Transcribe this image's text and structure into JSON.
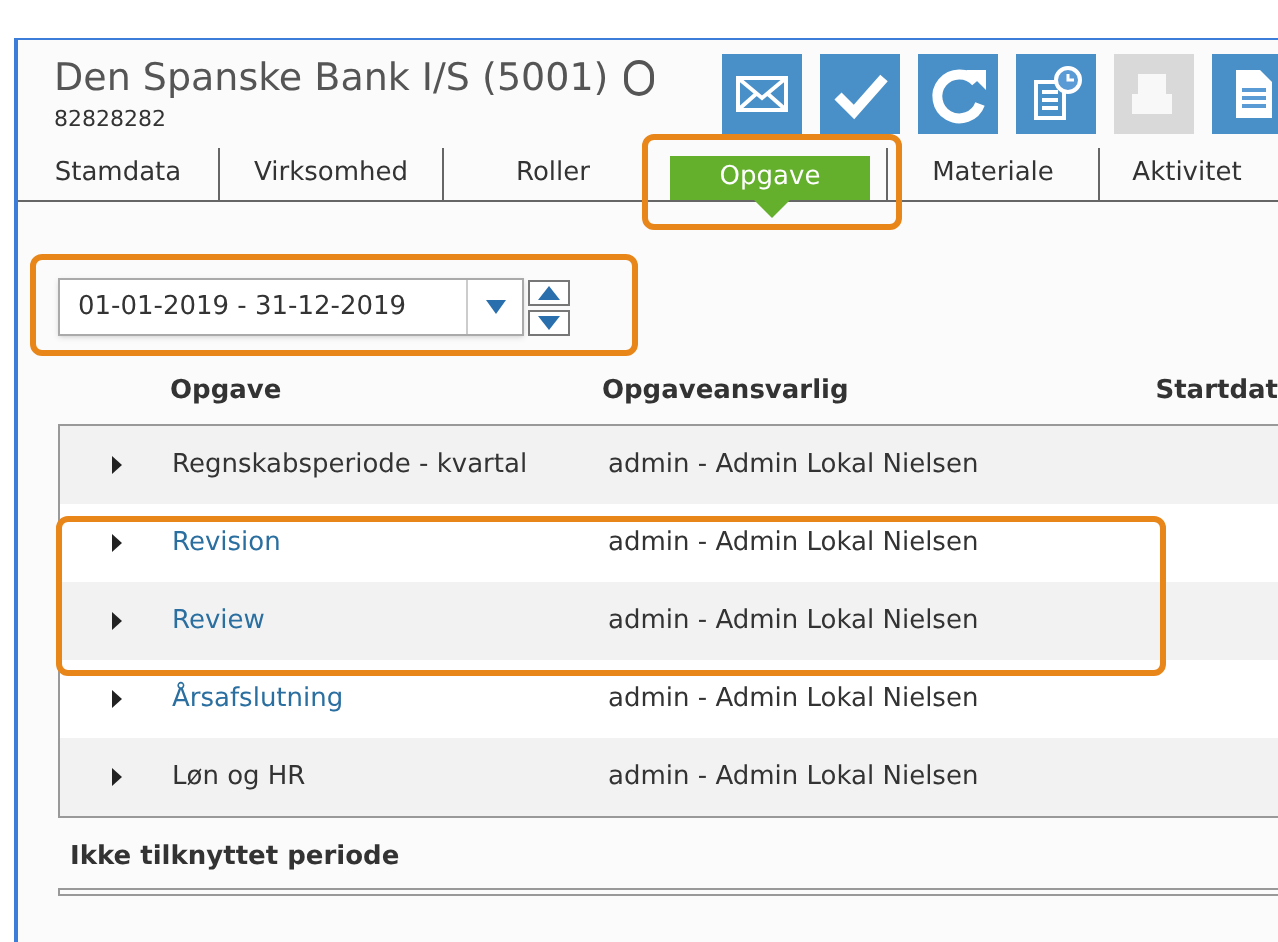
{
  "header": {
    "title": "Den Spanske Bank I/S (5001)",
    "number": "82828282"
  },
  "toolbar": [
    {
      "kind": "mail",
      "disabled": false
    },
    {
      "kind": "check",
      "disabled": false
    },
    {
      "kind": "refresh",
      "disabled": false
    },
    {
      "kind": "schedule",
      "disabled": false
    },
    {
      "kind": "print",
      "disabled": true
    },
    {
      "kind": "document",
      "disabled": false
    }
  ],
  "tabs": [
    {
      "label": "Stamdata",
      "selected": false,
      "highlighted": false
    },
    {
      "label": "Virksomhed",
      "selected": false,
      "highlighted": false
    },
    {
      "label": "Roller",
      "selected": false,
      "highlighted": false
    },
    {
      "label": "Opgave",
      "selected": true,
      "highlighted": true
    },
    {
      "label": "Materiale",
      "selected": false,
      "highlighted": false
    },
    {
      "label": "Aktivitet",
      "selected": false,
      "highlighted": false
    }
  ],
  "period": {
    "value": "01-01-2019 - 31-12-2019",
    "highlighted": true
  },
  "table": {
    "columns": [
      "Opgave",
      "Opgaveansvarlig",
      "Startdat"
    ],
    "rows": [
      {
        "task": "Regnskabsperiode - kvartal",
        "owner": "admin - Admin Lokal Nielsen",
        "link": false,
        "highlighted": false
      },
      {
        "task": "Revision",
        "owner": "admin - Admin Lokal Nielsen",
        "link": true,
        "highlighted": true
      },
      {
        "task": "Review",
        "owner": "admin - Admin Lokal Nielsen",
        "link": true,
        "highlighted": true
      },
      {
        "task": "Årsafslutning",
        "owner": "admin - Admin Lokal Nielsen",
        "link": true,
        "highlighted": false
      },
      {
        "task": "Løn og HR",
        "owner": "admin - Admin Lokal Nielsen",
        "link": false,
        "highlighted": false
      }
    ]
  },
  "footer": "Ikke tilknyttet periode"
}
